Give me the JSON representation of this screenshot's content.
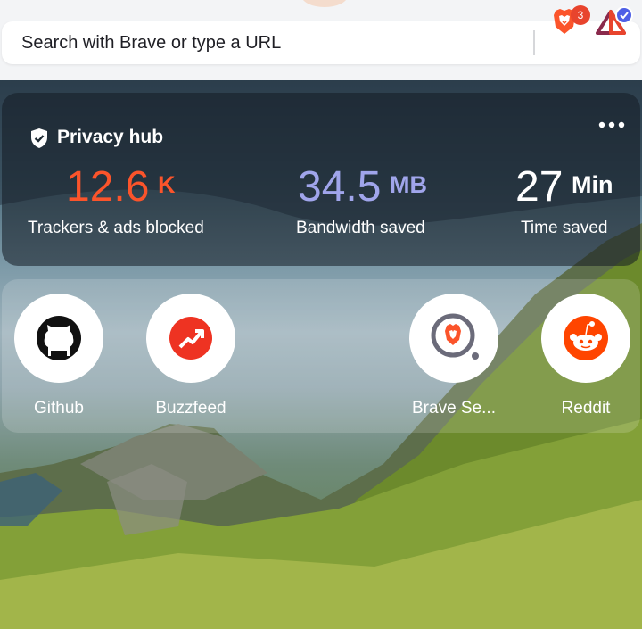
{
  "url_bar": {
    "placeholder": "Search with Brave or type a URL",
    "shields_count": "3"
  },
  "privacy_hub": {
    "title": "Privacy hub",
    "stats": [
      {
        "value": "12.6",
        "unit": "K",
        "label": "Trackers & ads blocked",
        "color": "#fb542b"
      },
      {
        "value": "34.5",
        "unit": "MB",
        "label": "Bandwidth saved",
        "color": "#a0a5eb"
      },
      {
        "value": "27",
        "unit": "Min",
        "label": "Time saved",
        "color": "#ffffff"
      }
    ]
  },
  "top_sites": [
    {
      "label": "Github",
      "icon": "github-icon"
    },
    {
      "label": "Buzzfeed",
      "icon": "buzzfeed-icon"
    },
    {
      "label": "Brave Se...",
      "icon": "brave-search-icon"
    },
    {
      "label": "Reddit",
      "icon": "reddit-icon"
    }
  ],
  "colors": {
    "brave_orange": "#fb542b",
    "reddit_orange": "#ff4500",
    "buzzfeed_red": "#ee3322",
    "rewards_blue": "#4e5fe6"
  }
}
